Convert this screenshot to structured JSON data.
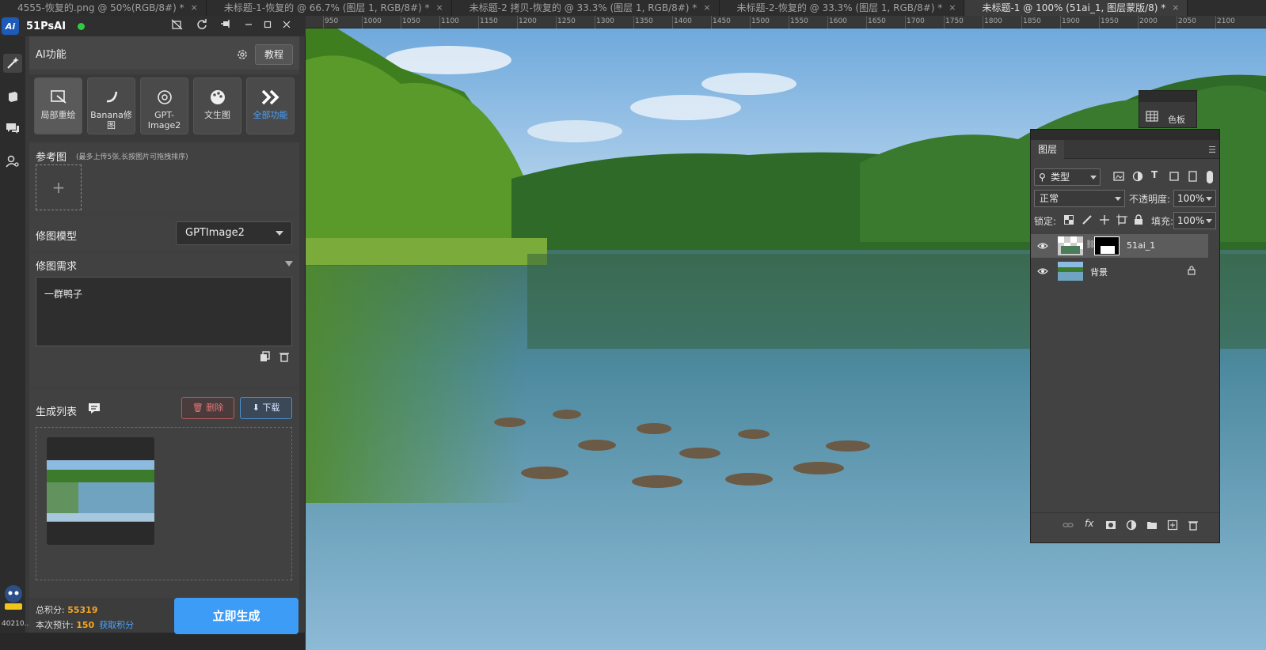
{
  "tabs": [
    {
      "label": "4555-恢复的.png @ 50%(RGB/8#) *",
      "active": false
    },
    {
      "label": "未标题-1-恢复的 @ 66.7% (图层 1, RGB/8#) *",
      "active": false
    },
    {
      "label": "未标题-2 拷贝-恢复的 @ 33.3% (图层 1, RGB/8#) *",
      "active": false
    },
    {
      "label": "未标题-2-恢复的 @ 33.3% (图层 1, RGB/8#) *",
      "active": false
    },
    {
      "label": "未标题-1 @ 100% (51ai_1, 图层蒙版/8) *",
      "active": true
    }
  ],
  "tab_close": "×",
  "ruler": [
    "950",
    "1000",
    "1050",
    "1100",
    "1150",
    "1200",
    "1250",
    "1300",
    "1350",
    "1400",
    "1450",
    "1500",
    "1550",
    "1600",
    "1650",
    "1700",
    "1750",
    "1800",
    "1850",
    "1900",
    "1950",
    "2000",
    "2050",
    "2100"
  ],
  "plugin": {
    "logo": "Ai",
    "title": "51PsAI",
    "section_title": "AI功能",
    "tutorial": "教程",
    "features": [
      {
        "label": "局部重绘"
      },
      {
        "label": "Banana修图"
      },
      {
        "label": "GPT-Image2"
      },
      {
        "label": "文生图"
      },
      {
        "label": "全部功能"
      }
    ],
    "ref_title": "参考图",
    "ref_hint": "(最多上传5张,长按图片可拖拽排序)",
    "ref_add": "+",
    "model_label": "修图模型",
    "model_value": "GPTImage2",
    "req_label": "修图需求",
    "req_text": "一群鸭子",
    "gen_title": "生成列表",
    "delete": "删除",
    "download": "下载",
    "total_label": "总积分:",
    "total_value": "55319",
    "est_label": "本次预计:",
    "est_value": "150",
    "earn": "获取积分",
    "generate": "立即生成",
    "user_id": "40210..."
  },
  "swatch": {
    "label": "色板"
  },
  "layers": {
    "tab": "图层",
    "filter": "类型",
    "blend": "正常",
    "opacity_label": "不透明度:",
    "opacity": "100%",
    "lock_label": "锁定:",
    "fill_label": "填充:",
    "fill": "100%",
    "items": [
      {
        "name": "51ai_1",
        "selected": true
      },
      {
        "name": "背景",
        "selected": false
      }
    ]
  }
}
